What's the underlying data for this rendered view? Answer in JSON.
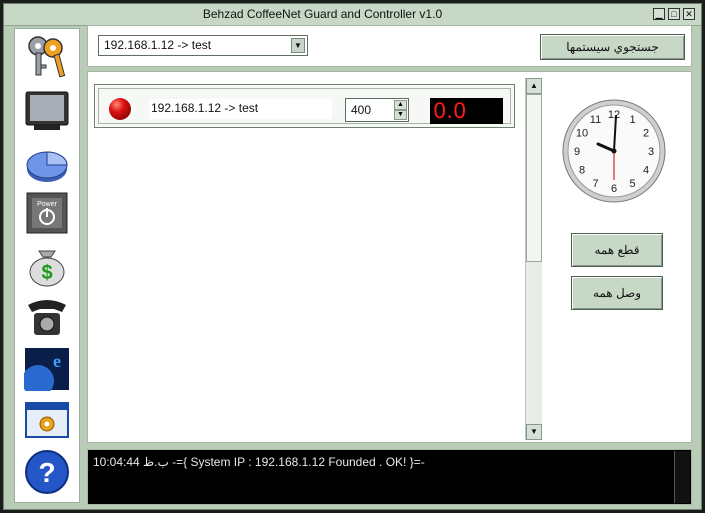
{
  "window": {
    "title": "Behzad CoffeeNet Guard and Controller v1.0"
  },
  "toolbar": {
    "system_select": "192.168.1.12 -> test",
    "search_systems_button": "جستجوي سيستمها"
  },
  "sidebar": {
    "items": [
      {
        "icon": "keys-icon"
      },
      {
        "icon": "monitor-icon"
      },
      {
        "icon": "pie-chart-icon"
      },
      {
        "icon": "power-icon",
        "label": "Power"
      },
      {
        "icon": "money-bag-icon",
        "label": "$"
      },
      {
        "icon": "telephone-icon"
      },
      {
        "icon": "internet-explorer-icon",
        "label": "e"
      },
      {
        "icon": "settings-window-icon"
      },
      {
        "icon": "help-icon",
        "label": "?"
      }
    ]
  },
  "systems": [
    {
      "name": "192.168.1.12 -> test",
      "rate": "400",
      "timer": "0.0",
      "status_color": "#cc1111"
    }
  ],
  "actions": {
    "disconnect_all": "قطع همه",
    "connect_all": "وصل همه"
  },
  "clock": {
    "numerals": [
      "12",
      "1",
      "2",
      "3",
      "4",
      "5",
      "6",
      "7",
      "8",
      "9",
      "10",
      "11"
    ]
  },
  "log": {
    "line": "10:04:44 ب.ظ -={ System IP : 192.168.1.12 Founded . OK! }=-"
  },
  "colors": {
    "frame": "#b8ccb8",
    "button": "#c7d8c7",
    "timer_text": "#ff1a1a"
  }
}
